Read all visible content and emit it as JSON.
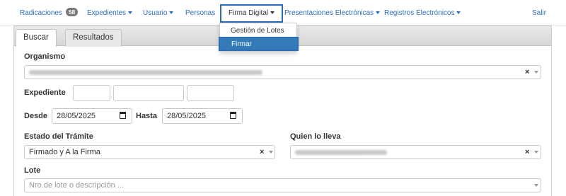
{
  "navbar": {
    "radicaciones": "Radicaciones",
    "radicaciones_count": "58",
    "expedientes": "Expedientes",
    "usuario": "Usuario",
    "personas": "Personas",
    "firma_digital": "Firma Digital",
    "presentaciones": "Presentaciones Electrónicas",
    "registros": "Registros Electrónicos",
    "salir": "Salir"
  },
  "dropdown": {
    "items": [
      "Gestión de Lotes",
      "Firmar"
    ],
    "selected": "Firmar"
  },
  "tabs": [
    "Buscar",
    "Resultados"
  ],
  "active_tab": "Buscar",
  "form": {
    "organismo_label": "Organismo",
    "expediente_label": "Expediente",
    "desde_label": "Desde",
    "desde_value": "28/05/2025",
    "hasta_label": "Hasta",
    "hasta_value": "28/05/2025",
    "estado_label": "Estado del Trámite",
    "estado_value": "Firmado y A la Firma",
    "quien_label": "Quien lo lleva",
    "lote_label": "Lote",
    "lote_placeholder": "Nro.de lote o descripción ...",
    "clear_symbol": "×"
  },
  "colors": {
    "link": "#2a6ebb",
    "selected_bg": "#337ab7",
    "badge_bg": "#777777"
  },
  "icons": {
    "caret": "chevron-down-icon",
    "date": "calendar-icon",
    "clear": "close-icon"
  }
}
